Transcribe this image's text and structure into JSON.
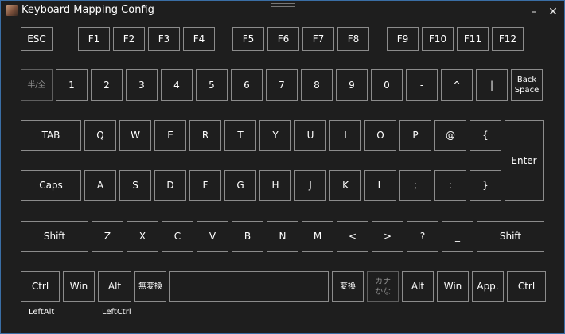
{
  "window": {
    "title": "Keyboard Mapping Config",
    "minimize_glyph": "–",
    "close_glyph": "✕"
  },
  "rows": {
    "function": [
      "ESC",
      "F1",
      "F2",
      "F3",
      "F4",
      "F5",
      "F6",
      "F7",
      "F8",
      "F9",
      "F10",
      "F11",
      "F12"
    ],
    "number": [
      "半/全",
      "1",
      "2",
      "3",
      "4",
      "5",
      "6",
      "7",
      "8",
      "9",
      "0",
      "-",
      "^",
      "|",
      "Back\nSpace"
    ],
    "top_alpha": [
      "TAB",
      "Q",
      "W",
      "E",
      "R",
      "T",
      "Y",
      "U",
      "I",
      "O",
      "P",
      "@",
      "{"
    ],
    "enter": "Enter",
    "home_alpha": [
      "Caps",
      "A",
      "S",
      "D",
      "F",
      "G",
      "H",
      "J",
      "K",
      "L",
      ";",
      ":",
      "}"
    ],
    "shift_row": [
      "Shift",
      "Z",
      "X",
      "C",
      "V",
      "B",
      "N",
      "M",
      "<",
      ">",
      "?",
      "_",
      "Shift"
    ],
    "bottom": [
      "Ctrl",
      "Win",
      "Alt",
      "無変換",
      "",
      "変換",
      "カナ\nかな",
      "Alt",
      "Win",
      "App.",
      "Ctrl"
    ]
  },
  "captions": {
    "ctrl_mapping": "LeftAlt",
    "alt_mapping": "LeftCtrl"
  },
  "colors": {
    "background": "#1e1e1e",
    "key_border": "#8c8c8c",
    "disabled_text": "#8e8e8e",
    "window_border": "#3a6ea5"
  }
}
